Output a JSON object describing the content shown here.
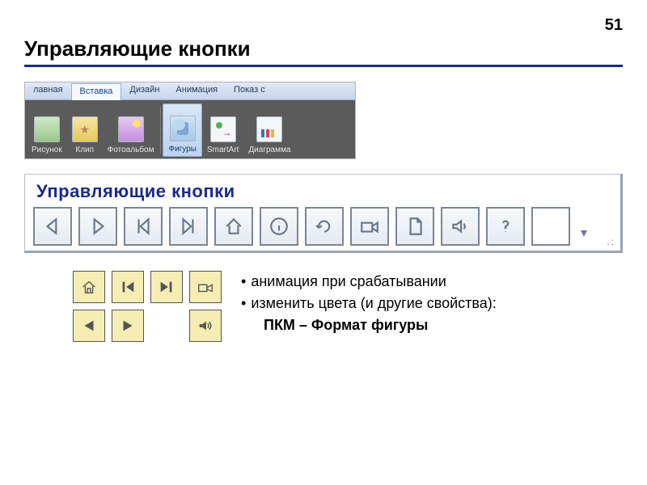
{
  "page_number": "51",
  "title": "Управляющие кнопки",
  "ribbon": {
    "tabs": [
      "лавная",
      "Вставка",
      "Дизайн",
      "Анимация",
      "Показ с"
    ],
    "active_tab_index": 1,
    "buttons": [
      {
        "label": "Рисунок",
        "icon": "picture"
      },
      {
        "label": "Клип",
        "icon": "clip"
      },
      {
        "label": "Фотоальбом",
        "icon": "album"
      },
      {
        "label": "Фигуры",
        "icon": "shapes",
        "active": true
      },
      {
        "label": "SmartArt",
        "icon": "smart"
      },
      {
        "label": "Диаграмма",
        "icon": "chart"
      }
    ]
  },
  "panel": {
    "title": "Управляющие кнопки",
    "buttons": [
      "back",
      "forward",
      "first",
      "last",
      "home",
      "info",
      "return",
      "movie",
      "document",
      "sound",
      "help",
      "custom"
    ]
  },
  "yellow_buttons": [
    "home",
    "first",
    "last",
    "movie",
    "back",
    "forward",
    "empty-slot",
    "sound"
  ],
  "notes": {
    "line1": "анимация при срабатывании",
    "line2": "изменить цвета (и другие свойства):",
    "line3_bold": "ПКМ – Формат фигуры"
  }
}
